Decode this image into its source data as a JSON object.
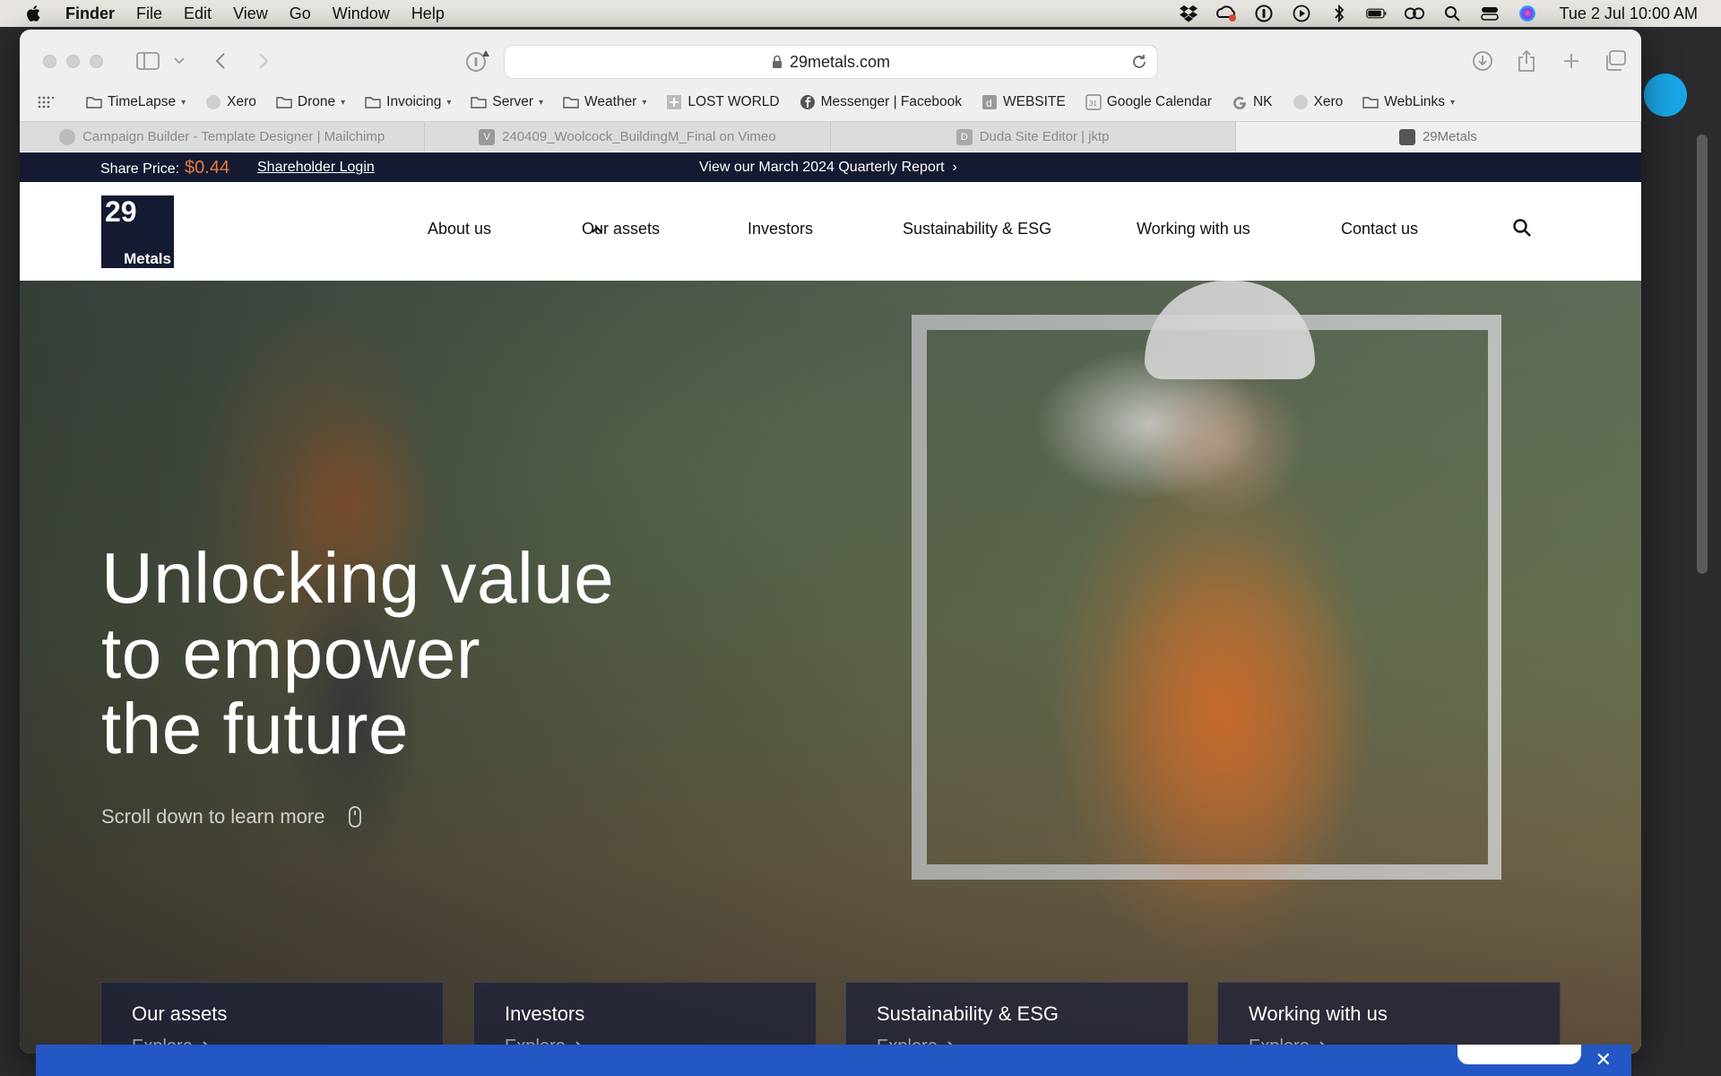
{
  "menubar": {
    "app_name": "Finder",
    "items": [
      "File",
      "Edit",
      "View",
      "Go",
      "Window",
      "Help"
    ],
    "clock": "Tue 2 Jul  10:00 AM"
  },
  "browser": {
    "url": "29metals.com",
    "bookmarks": [
      {
        "label": "TimeLapse",
        "icon": "folder-icon",
        "dropdown": true
      },
      {
        "label": "Xero",
        "icon": "xero-icon",
        "dropdown": false
      },
      {
        "label": "Drone",
        "icon": "folder-icon",
        "dropdown": true
      },
      {
        "label": "Invoicing",
        "icon": "folder-icon",
        "dropdown": true
      },
      {
        "label": "Server",
        "icon": "folder-icon",
        "dropdown": true
      },
      {
        "label": "Weather",
        "icon": "folder-icon",
        "dropdown": true
      },
      {
        "label": "LOST WORLD",
        "icon": "plus-square-icon",
        "dropdown": false
      },
      {
        "label": "Messenger | Facebook",
        "icon": "facebook-icon",
        "dropdown": false
      },
      {
        "label": "WEBSITE",
        "icon": "duda-icon",
        "dropdown": false
      },
      {
        "label": "Google Calendar",
        "icon": "calendar-icon",
        "dropdown": false
      },
      {
        "label": "NK",
        "icon": "google-icon",
        "dropdown": false
      },
      {
        "label": "Xero",
        "icon": "xero-icon",
        "dropdown": false
      },
      {
        "label": "WebLinks",
        "icon": "folder-icon",
        "dropdown": true
      }
    ],
    "tabs": [
      {
        "label": "Campaign Builder - Template Designer | Mailchimp",
        "active": false
      },
      {
        "label": "240409_Woolcock_BuildingM_Final on Vimeo",
        "active": false
      },
      {
        "label": "Duda Site Editor | jktp",
        "active": false
      },
      {
        "label": "29Metals",
        "active": true
      }
    ]
  },
  "site": {
    "topbar": {
      "share_label": "Share Price:",
      "share_price": "$0.44",
      "login": "Shareholder Login",
      "report": "View our March 2024 Quarterly Report"
    },
    "logo": {
      "number": "29",
      "word": "Metals"
    },
    "nav": [
      "About us",
      "Our assets",
      "Investors",
      "Sustainability & ESG",
      "Working with us",
      "Contact us"
    ],
    "hero": {
      "headline": [
        "Unlocking value",
        "to empower",
        "the future"
      ],
      "scroll_hint": "Scroll down to learn more"
    },
    "cards": [
      {
        "title": "Our assets",
        "cta": "Explore"
      },
      {
        "title": "Investors",
        "cta": "Explore"
      },
      {
        "title": "Sustainability & ESG",
        "cta": "Explore"
      },
      {
        "title": "Working with us",
        "cta": "Explore"
      }
    ]
  },
  "colors": {
    "navy": "#141a32",
    "accent_orange": "#e9793a",
    "banner_blue": "#2257c4"
  }
}
